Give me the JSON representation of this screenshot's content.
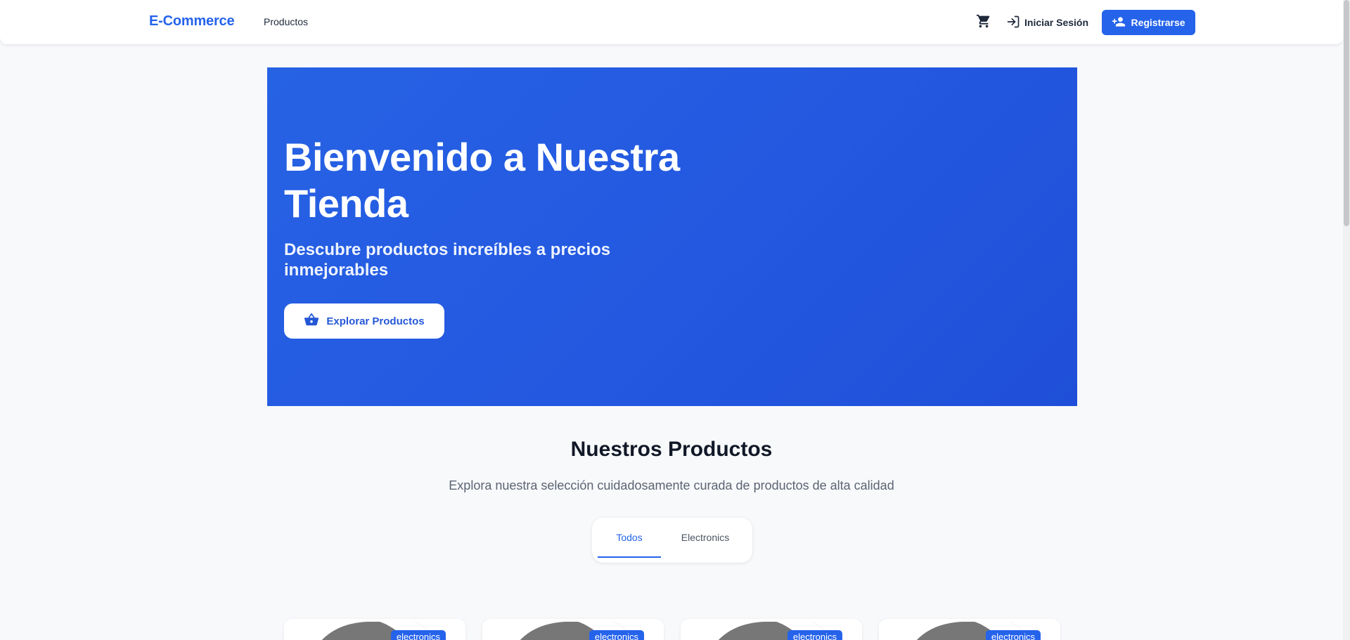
{
  "header": {
    "brand": "E-Commerce",
    "nav": {
      "products": "Productos"
    },
    "cart_icon": "shopping-cart-icon",
    "login_label": "Iniciar Sesión",
    "register_label": "Registrarse"
  },
  "hero": {
    "title": "Bienvenido a Nuestra Tienda",
    "subtitle": "Descubre productos increíbles a precios inmejorables",
    "cta_label": "Explorar Productos",
    "bg_color": "#2563eb"
  },
  "products_section": {
    "title": "Nuestros Productos",
    "description": "Explora nuestra selección cuidadosamente curada de productos de alta calidad",
    "tabs": [
      {
        "label": "Todos",
        "active": true
      },
      {
        "label": "Electronics",
        "active": false
      }
    ],
    "cards": [
      {
        "badge": "electronics"
      },
      {
        "badge": "electronics"
      },
      {
        "badge": "electronics"
      },
      {
        "badge": "electronics"
      }
    ]
  },
  "colors": {
    "accent": "#2563eb",
    "background": "#f8f9fb"
  }
}
